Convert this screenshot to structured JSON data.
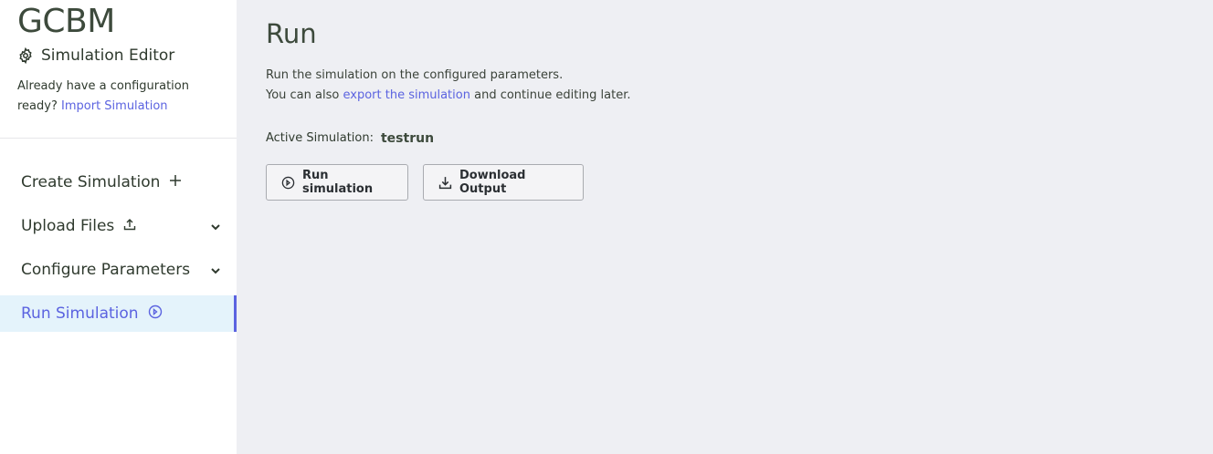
{
  "sidebar": {
    "brand": "GCBM",
    "subtitle": "Simulation Editor",
    "intro_text": "Already have a configuration ready?",
    "import_link": "Import Simulation",
    "items": [
      {
        "label": "Create Simulation",
        "icon": "plus-icon"
      },
      {
        "label": "Upload Files",
        "icon": "upload-icon",
        "chevron": "chevron-down-icon"
      },
      {
        "label": "Configure Parameters",
        "chevron": "chevron-down-icon"
      },
      {
        "label": "Run Simulation",
        "icon": "play-circle-icon",
        "active": true
      }
    ]
  },
  "main": {
    "title": "Run",
    "desc_line1": "Run the simulation on the configured parameters.",
    "desc_line2_pre": "You can also",
    "desc_line2_link": "export the simulation",
    "desc_line2_post": "and continue editing later.",
    "active_label": "Active Simulation:",
    "active_value": "testrun",
    "buttons": {
      "run": "Run simulation",
      "download": "Download Output"
    }
  },
  "colors": {
    "accent": "#5b63e0",
    "active_bg": "#e4f3fb",
    "main_bg": "#eeeff3"
  }
}
